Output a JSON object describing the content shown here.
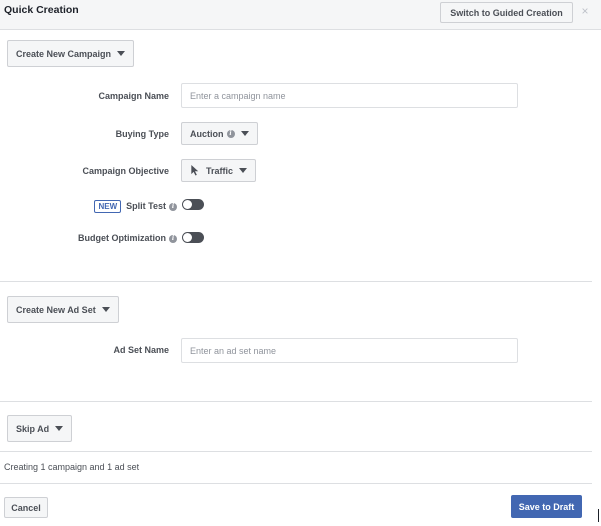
{
  "header": {
    "title": "Quick Creation",
    "guided_button": "Switch to Guided Creation",
    "close_glyph": "×"
  },
  "campaign": {
    "dropdown_label": "Create New Campaign",
    "name_label": "Campaign Name",
    "name_placeholder": "Enter a campaign name",
    "name_value": "",
    "buying_type_label": "Buying Type",
    "buying_type_value": "Auction",
    "objective_label": "Campaign Objective",
    "objective_value": "Traffic",
    "objective_icon": "cursor-pointer-icon",
    "new_badge": "NEW",
    "split_test_label": "Split Test",
    "split_test_on": false,
    "budget_label": "Budget Optimization",
    "budget_on": false
  },
  "ad_set": {
    "dropdown_label": "Create New Ad Set",
    "name_label": "Ad Set Name",
    "name_placeholder": "Enter an ad set name",
    "name_value": ""
  },
  "ad": {
    "dropdown_label": "Skip Ad"
  },
  "status": "Creating 1 campaign and 1 ad set",
  "footer": {
    "cancel": "Cancel",
    "save": "Save to Draft"
  },
  "colors": {
    "primary": "#4267b2",
    "toggle_off": "#4b4f56",
    "border": "#dddfe2"
  }
}
